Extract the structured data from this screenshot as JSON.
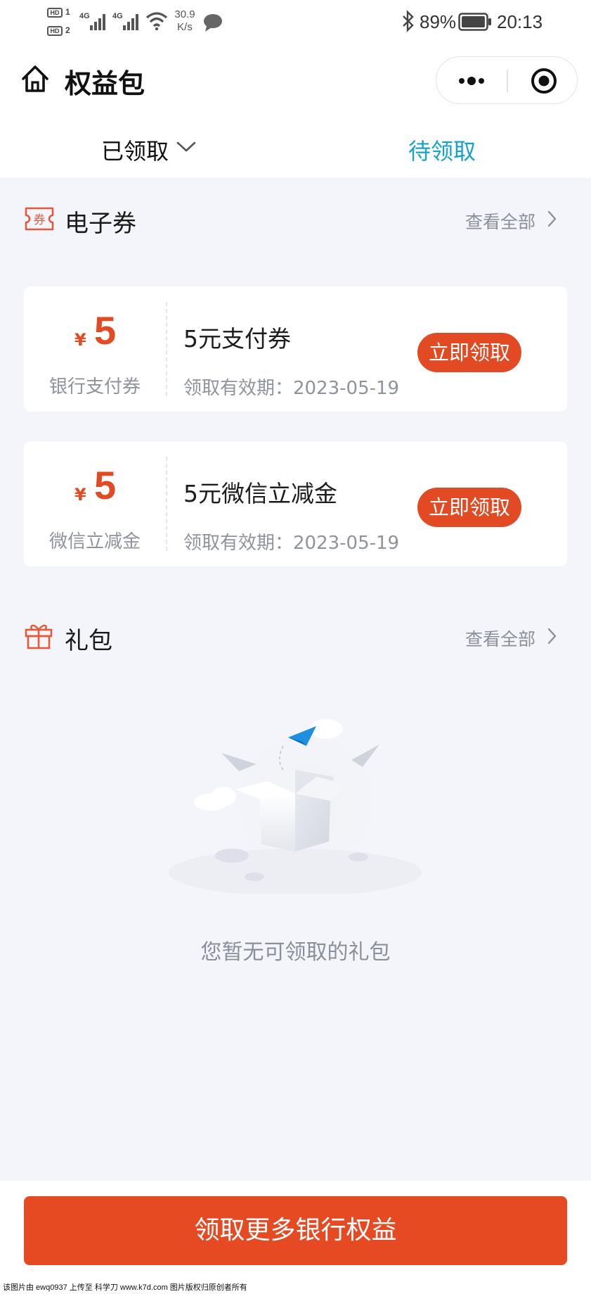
{
  "status_bar": {
    "hd1": "HD",
    "sim1": "1",
    "hd2": "HD",
    "sim2": "2",
    "net1": "4G",
    "net2": "4G",
    "speed_value": "30.9",
    "speed_unit": "K/s",
    "battery": "89%",
    "battery_level": 0.89,
    "time": "20:13"
  },
  "nav": {
    "title": "权益包",
    "home_icon": "home-icon",
    "more_icon": "more-dots-icon",
    "close_icon": "target-circle-icon"
  },
  "tabs": [
    {
      "label": "已领取",
      "active": false
    },
    {
      "label": "待领取",
      "active": true
    }
  ],
  "colors": {
    "accent_orange": "#e14a22",
    "tab_active_blue": "#17a2c9",
    "background": "#f3f5fa",
    "muted_text": "#8f939b"
  },
  "coupon_section": {
    "icon": "coupon-ticket-icon",
    "icon_text": "券",
    "title": "电子券",
    "view_all": "查看全部"
  },
  "coupons": [
    {
      "currency": "¥",
      "amount": "5",
      "type": "银行支付券",
      "name": "5元支付券",
      "validity": "领取有效期：2023-05-19",
      "action": "立即领取"
    },
    {
      "currency": "¥",
      "amount": "5",
      "type": "微信立减金",
      "name": "5元微信立减金",
      "validity": "领取有效期：2023-05-19",
      "action": "立即领取"
    }
  ],
  "gift_section": {
    "icon": "gift-icon",
    "title": "礼包",
    "view_all": "查看全部",
    "empty_illustration": "empty-box-illustration",
    "empty_text": "您暂无可领取的礼包"
  },
  "bottom_button": "领取更多银行权益",
  "watermark": "该图片由 ewq0937 上传至 科学刀 www.k7d.com 图片版权归原创者所有"
}
